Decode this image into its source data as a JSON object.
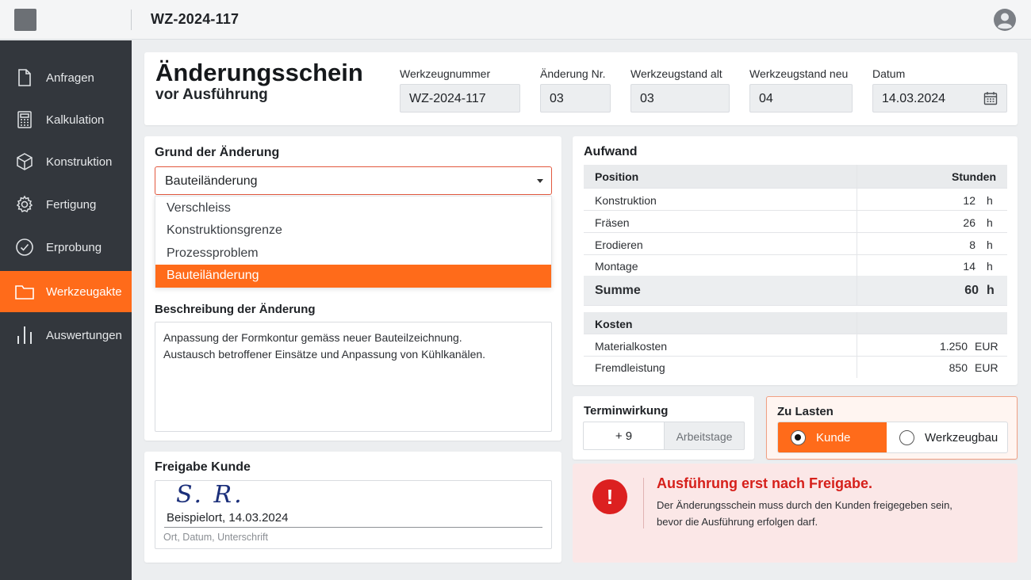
{
  "app": {
    "title": "WZ-2024-117"
  },
  "sidebar": {
    "items": [
      {
        "label": "Anfragen",
        "icon": "document-icon"
      },
      {
        "label": "Kalkulation",
        "icon": "calculator-icon"
      },
      {
        "label": "Konstruktion",
        "icon": "cube-icon"
      },
      {
        "label": "Fertigung",
        "icon": "gear-icon"
      },
      {
        "label": "Erprobung",
        "icon": "check-circle-icon"
      },
      {
        "label": "Werkzeugakte",
        "icon": "folder-icon",
        "active": true
      },
      {
        "label": "Auswertungen",
        "icon": "bar-chart-icon"
      }
    ]
  },
  "header": {
    "title": "Änderungsschein",
    "subtitle": "vor Ausführung",
    "fields": {
      "werkzeugnummer": {
        "label": "Werkzeugnummer",
        "value": "WZ-2024-117"
      },
      "aenderung_nr": {
        "label": "Änderung Nr.",
        "value": "03"
      },
      "stand_alt": {
        "label": "Werkzeugstand alt",
        "value": "03"
      },
      "stand_neu": {
        "label": "Werkzeugstand neu",
        "value": "04"
      },
      "datum": {
        "label": "Datum",
        "value": "14.03.2024"
      }
    }
  },
  "grund": {
    "title": "Grund der Änderung",
    "selected": "Bauteiländerung",
    "options": [
      "Verschleiss",
      "Konstruktionsgrenze",
      "Prozessproblem",
      "Bauteiländerung"
    ]
  },
  "beschreibung": {
    "title": "Beschreibung der Änderung",
    "line1": "Anpassung der Formkontur gemäss neuer Bauteilzeichnung.",
    "line2": "Austausch betroffener Einsätze und Anpassung von Kühlkanälen."
  },
  "freigabe": {
    "title": "Freigabe Kunde",
    "signature": "S. R.",
    "place_date": "Beispielort, 14.03.2024",
    "hint": "Ort, Datum, Unterschrift"
  },
  "aufwand": {
    "title": "Aufwand",
    "col_position": "Position",
    "col_stunden": "Stunden",
    "rows": [
      {
        "label": "Konstruktion",
        "value": "12",
        "unit": "h"
      },
      {
        "label": "Fräsen",
        "value": "26",
        "unit": "h"
      },
      {
        "label": "Erodieren",
        "value": "8",
        "unit": "h"
      },
      {
        "label": "Montage",
        "value": "14",
        "unit": "h"
      }
    ],
    "sum": {
      "label": "Summe",
      "value": "60",
      "unit": "h"
    },
    "kosten_title": "Kosten",
    "kosten": [
      {
        "label": "Materialkosten",
        "value": "1.250",
        "unit": "EUR"
      },
      {
        "label": "Fremdleistung",
        "value": "850",
        "unit": "EUR"
      }
    ]
  },
  "termin": {
    "title": "Terminwirkung",
    "value": "+ 9",
    "unit": "Arbeitstage"
  },
  "zulasten": {
    "title": "Zu Lasten",
    "options": [
      {
        "label": "Kunde",
        "selected": true
      },
      {
        "label": "Werkzeugbau",
        "selected": false
      }
    ]
  },
  "alert": {
    "icon": "!",
    "title": "Ausführung erst nach Freigabe.",
    "line1": "Der Änderungsschein muss durch den Kunden freigegeben sein,",
    "line2": "bevor die Ausführung erfolgen darf."
  },
  "colors": {
    "accent": "#ff6b1a",
    "sidebar": "#33373d",
    "alert": "#d6201b"
  }
}
